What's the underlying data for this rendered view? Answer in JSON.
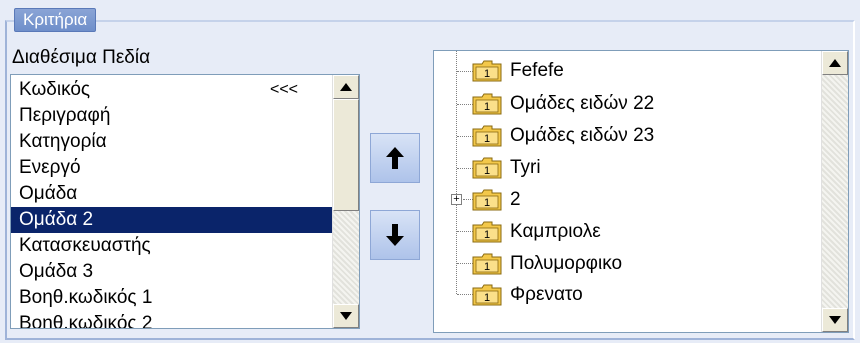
{
  "group": {
    "title": "Κριτήρια"
  },
  "available": {
    "label": "Διαθέσιμα Πεδία",
    "sort_indicator": "<<<",
    "items": [
      {
        "label": "Κωδικός"
      },
      {
        "label": "Περιγραφή"
      },
      {
        "label": "Κατηγορία"
      },
      {
        "label": "Ενεργό"
      },
      {
        "label": "Ομάδα"
      },
      {
        "label": "Ομάδα 2"
      },
      {
        "label": "Κατασκευαστής"
      },
      {
        "label": "Ομάδα 3"
      },
      {
        "label": "Βοηθ.κωδικός 1"
      },
      {
        "label": "Βοηθ.κωδικός 2"
      }
    ],
    "selected_index": 5
  },
  "buttons": {
    "move_up_icon": "up-arrow-icon",
    "move_down_icon": "down-arrow-icon"
  },
  "tree": {
    "items": [
      {
        "label": "Fefefe"
      },
      {
        "label": "Ομάδες ειδών 22"
      },
      {
        "label": "Ομάδες ειδών 23"
      },
      {
        "label": "Tyri"
      },
      {
        "label": "2",
        "expandable": true,
        "expander": "+"
      },
      {
        "label": "Καμπριολε"
      },
      {
        "label": "Πολυμορφικο"
      },
      {
        "label": "Φρενατο"
      }
    ],
    "folder_badge": "1"
  },
  "colors": {
    "selection": "#0a246a",
    "panel_bg": "#e7ecf7",
    "legend_bg": "#7a97cf",
    "folder": "#f3c84a"
  }
}
